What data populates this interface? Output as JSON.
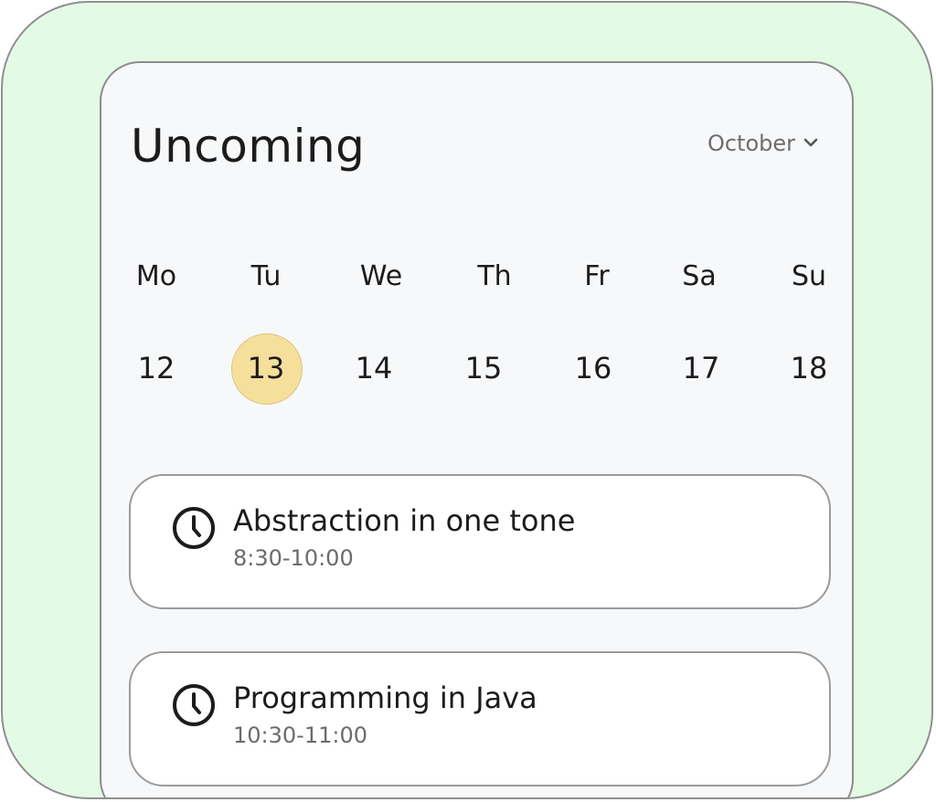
{
  "header": {
    "title": "Uncoming",
    "month": "October"
  },
  "calendar": {
    "weekdays": [
      "Mo",
      "Tu",
      "We",
      "Th",
      "Fr",
      "Sa",
      "Su"
    ],
    "dates": [
      "12",
      "13",
      "14",
      "15",
      "16",
      "17",
      "18"
    ],
    "selected_date": "13",
    "selected_color": "#f5df9b"
  },
  "events": [
    {
      "title": "Abstraction in one tone",
      "time": "8:30-10:00",
      "icon": "clock-icon"
    },
    {
      "title": "Programming in Java",
      "time": "10:30-11:00",
      "icon": "clock-icon"
    }
  ],
  "colors": {
    "background": "#e3fbe5",
    "card": "#f7f8fa",
    "accent": "#f5df9b"
  }
}
